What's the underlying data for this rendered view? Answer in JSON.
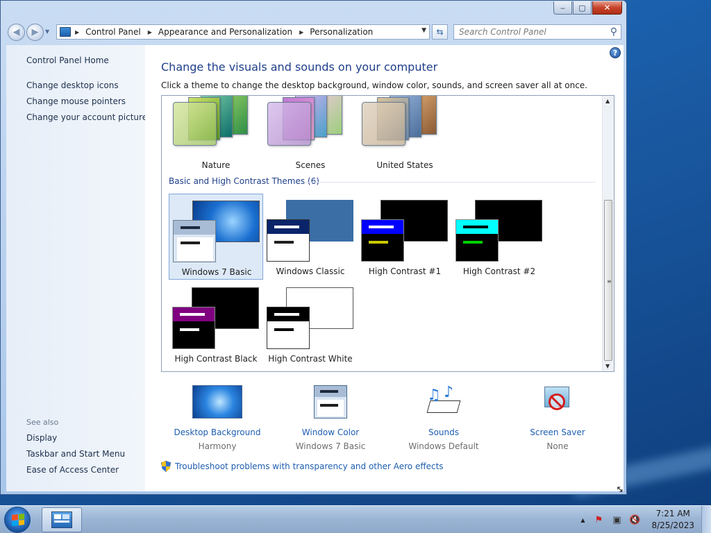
{
  "window": {
    "controls": {
      "minimize": "‒",
      "maximize": "▢",
      "close": "✕"
    }
  },
  "navigation": {
    "breadcrumbs": [
      "Control Panel",
      "Appearance and Personalization",
      "Personalization"
    ],
    "search_placeholder": "Search Control Panel"
  },
  "sidebar": {
    "home": "Control Panel Home",
    "links": [
      "Change desktop icons",
      "Change mouse pointers",
      "Change your account picture"
    ],
    "see_also_heading": "See also",
    "see_also": [
      "Display",
      "Taskbar and Start Menu",
      "Ease of Access Center"
    ]
  },
  "main": {
    "title": "Change the visuals and sounds on your computer",
    "description": "Click a theme to change the desktop background, window color, sounds, and screen saver all at once.",
    "aero_themes": [
      "Nature",
      "Scenes",
      "United States"
    ],
    "basic_section_title": "Basic and High Contrast Themes (6)",
    "basic_themes": [
      "Windows 7 Basic",
      "Windows Classic",
      "High Contrast #1",
      "High Contrast #2",
      "High Contrast Black",
      "High Contrast White"
    ],
    "selected_theme": "Windows 7 Basic",
    "settings": [
      {
        "label": "Desktop Background",
        "value": "Harmony",
        "icon": "desktop-background-icon"
      },
      {
        "label": "Window Color",
        "value": "Windows 7 Basic",
        "icon": "window-color-icon"
      },
      {
        "label": "Sounds",
        "value": "Windows Default",
        "icon": "sounds-icon"
      },
      {
        "label": "Screen Saver",
        "value": "None",
        "icon": "screen-saver-icon"
      }
    ],
    "troubleshoot_link": "Troubleshoot problems with transparency and other Aero effects"
  },
  "taskbar": {
    "time": "7:21 AM",
    "date": "8/25/2023"
  },
  "colors": {
    "link": "#1e5eb0",
    "title": "#1e3e8a",
    "selection": "#dde9f7"
  }
}
